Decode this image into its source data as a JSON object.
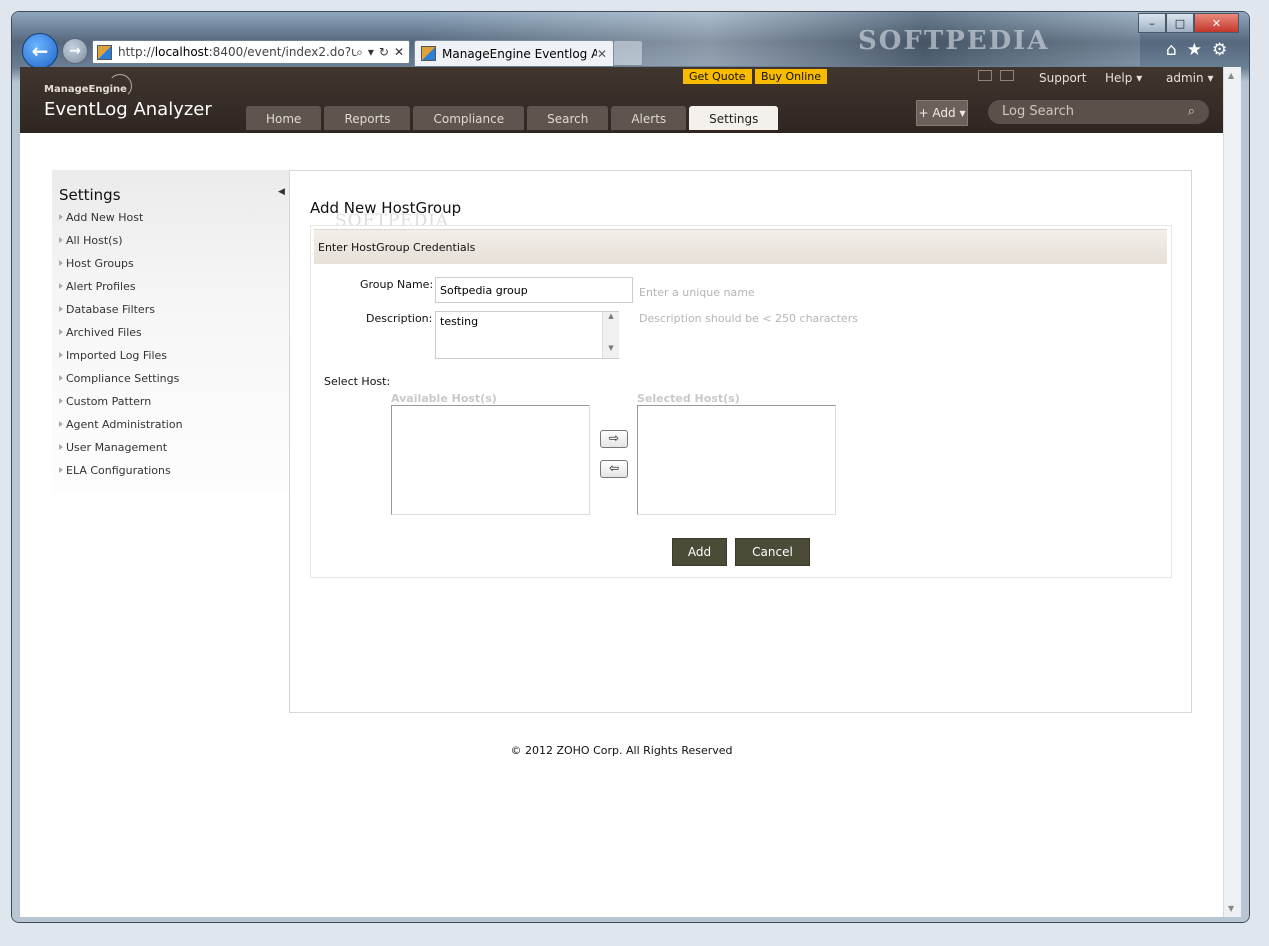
{
  "browser": {
    "address_prefix": "http://",
    "address_host": "localhost",
    "address_rest": ":8400/event/index2.do?url:",
    "tab_title": "ManageEngine Eventlog An...",
    "watermark": "SOFTPEDIA"
  },
  "header": {
    "brand_small": "ManageEngine",
    "brand_main": "EventLog Analyzer",
    "get_quote": "Get Quote",
    "buy_online": "Buy Online",
    "support": "Support",
    "help": "Help",
    "user": "admin",
    "tabs": [
      {
        "label": "Home"
      },
      {
        "label": "Reports"
      },
      {
        "label": "Compliance"
      },
      {
        "label": "Search"
      },
      {
        "label": "Alerts"
      },
      {
        "label": "Settings",
        "active": true
      }
    ],
    "add_label": "+ Add",
    "log_search_placeholder": "Log Search"
  },
  "sidebar": {
    "title": "Settings",
    "items": [
      {
        "label": "Add New Host"
      },
      {
        "label": "All Host(s)"
      },
      {
        "label": "Host Groups"
      },
      {
        "label": "Alert Profiles"
      },
      {
        "label": "Database Filters"
      },
      {
        "label": "Archived Files"
      },
      {
        "label": "Imported Log Files"
      },
      {
        "label": "Compliance Settings"
      },
      {
        "label": "Custom Pattern"
      },
      {
        "label": "Agent Administration"
      },
      {
        "label": "User Management"
      },
      {
        "label": "ELA Configurations"
      }
    ]
  },
  "main": {
    "heading": "Add New HostGroup",
    "heading_watermark": "SOFTPEDIA",
    "section_title": "Enter HostGroup Credentials",
    "group_name_label": "Group Name:",
    "group_name_value": "Softpedia group",
    "group_name_hint": "Enter a unique name",
    "description_label": "Description:",
    "description_value": "testing",
    "description_hint": "Description should be < 250 characters",
    "select_host_label": "Select Host:",
    "available_hosts_header": "Available Host(s)",
    "selected_hosts_header": "Selected Host(s)",
    "add_button": "Add",
    "cancel_button": "Cancel"
  },
  "footer": {
    "copyright": "© 2012 ZOHO Corp. All Rights Reserved"
  },
  "colors": {
    "header_bg": "#3a302b",
    "accent_yellow": "#f9bb00",
    "button_dark": "#4b4b38"
  }
}
